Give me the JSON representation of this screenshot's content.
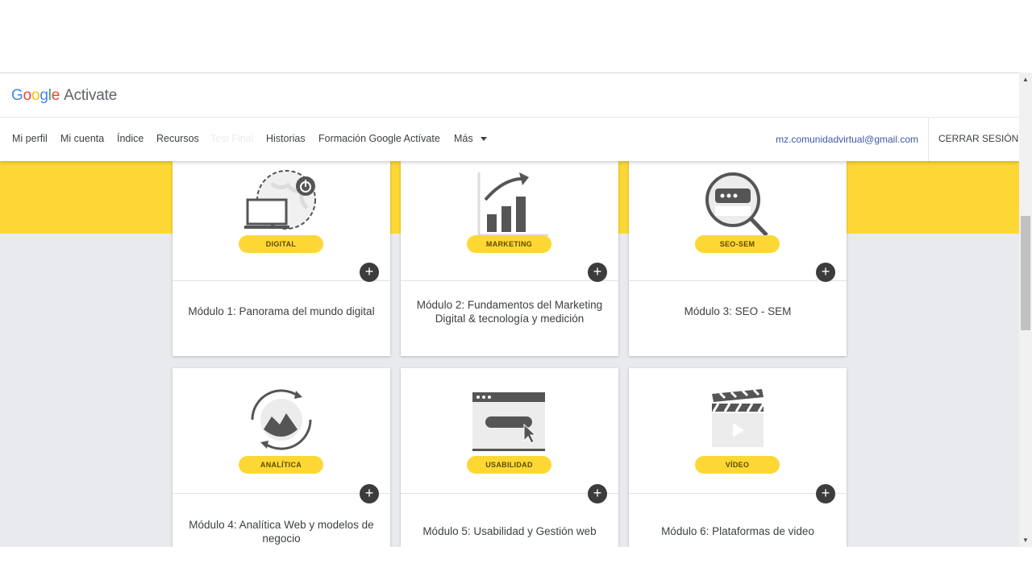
{
  "brand": {
    "google": [
      "G",
      "o",
      "o",
      "g",
      "l",
      "e"
    ],
    "name": "Activate"
  },
  "nav": {
    "items": [
      "Mi perfil",
      "Mi cuenta",
      "Índice",
      "Recursos",
      "Test Final",
      "Historias",
      "Formación Google Actívate",
      "Más"
    ],
    "email": "mz.comunidadvirtual@gmail.com",
    "logout": "CERRAR SESIÓN"
  },
  "modules": [
    {
      "badge": "DIGITAL",
      "title": "Módulo 1: Panorama del mundo digital",
      "icon": "globe-laptop-power-icon"
    },
    {
      "badge": "MARKETING",
      "title": "Módulo 2: Fundamentos del Marketing Digital & tecnología y medición",
      "icon": "growth-chart-icon"
    },
    {
      "badge": "SEO-SEM",
      "title": "Módulo 3: SEO - SEM",
      "icon": "magnifier-browser-icon"
    },
    {
      "badge": "ANALÍTICA",
      "title": "Módulo 4: Analítica Web y modelos de negocio",
      "icon": "analytics-cycle-icon"
    },
    {
      "badge": "USABILIDAD",
      "title": "Módulo 5: Usabilidad y Gestión web",
      "icon": "browser-cursor-icon"
    },
    {
      "badge": "VÍDEO",
      "title": "Módulo 6: Plataformas de video",
      "icon": "clapperboard-icon"
    }
  ],
  "colors": {
    "accent_yellow": "#fdd835",
    "dark_button": "#3c3c3c",
    "link_blue": "#3e5aa9"
  }
}
